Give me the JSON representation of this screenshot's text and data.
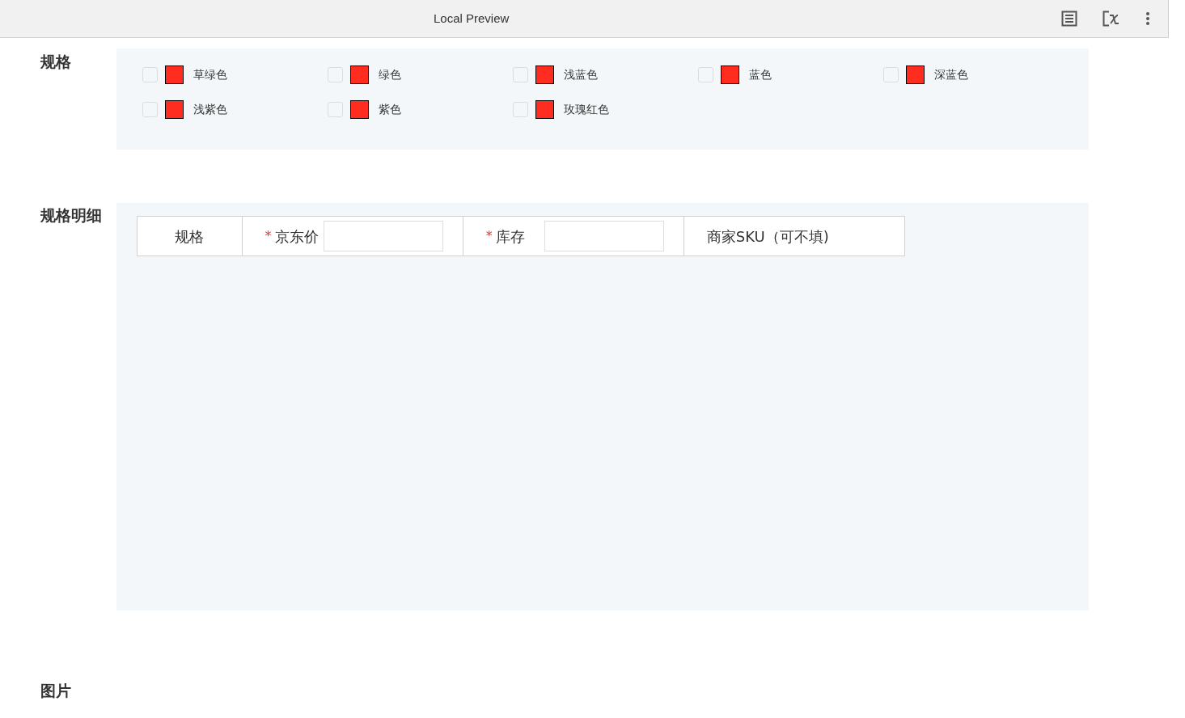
{
  "window": {
    "title": "Local Preview"
  },
  "spec": {
    "label": "规格",
    "options": [
      {
        "name": "草绿色",
        "checked": false,
        "color": "#ff2d20"
      },
      {
        "name": "绿色",
        "checked": false,
        "color": "#ff2d20"
      },
      {
        "name": "浅蓝色",
        "checked": false,
        "color": "#ff2d20"
      },
      {
        "name": "蓝色",
        "checked": false,
        "color": "#ff2d20"
      },
      {
        "name": "深蓝色",
        "checked": false,
        "color": "#ff2d20"
      },
      {
        "name": "浅紫色",
        "checked": false,
        "color": "#ff2d20"
      },
      {
        "name": "紫色",
        "checked": false,
        "color": "#ff2d20"
      },
      {
        "name": "玫瑰红色",
        "checked": false,
        "color": "#ff2d20"
      }
    ]
  },
  "spec_detail": {
    "label": "规格明细",
    "columns": [
      {
        "kind": "plain",
        "label": "规格"
      },
      {
        "kind": "input",
        "label": "京东价",
        "required_mark": "*"
      },
      {
        "kind": "input",
        "label": "库存",
        "required_mark": "*"
      },
      {
        "kind": "plain",
        "label": "商家SKU（可不填)"
      }
    ]
  },
  "images": {
    "label": "图片"
  }
}
